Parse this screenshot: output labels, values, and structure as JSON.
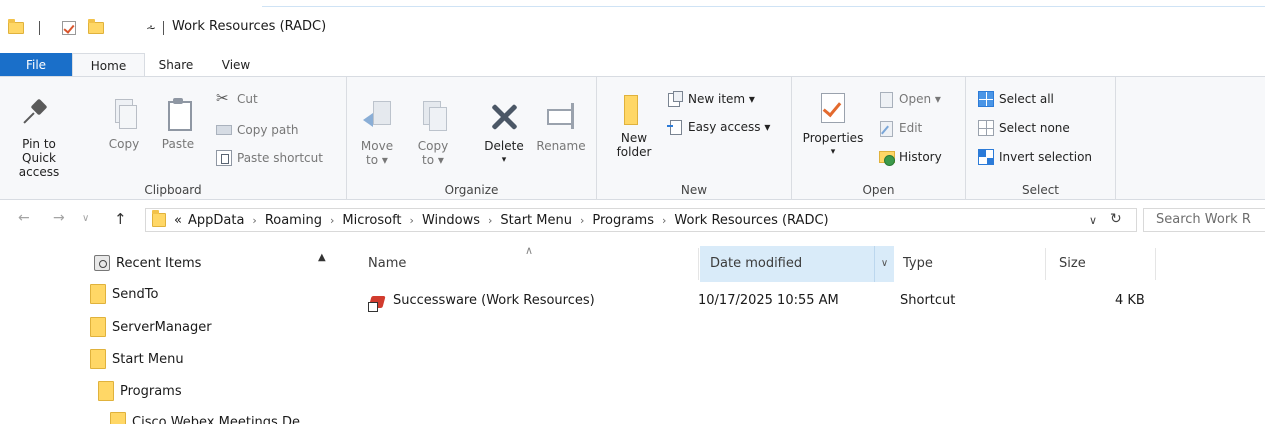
{
  "window": {
    "title": "Work Resources (RADC)"
  },
  "tabs": [
    "File",
    "Home",
    "Share",
    "View"
  ],
  "ribbon": {
    "clipboard": {
      "label": "Clipboard",
      "pin_to_quick_access_line1": "Pin to Quick",
      "pin_to_quick_access_line2": "access",
      "copy": "Copy",
      "paste": "Paste",
      "cut": "Cut",
      "copy_path": "Copy path",
      "paste_shortcut": "Paste shortcut"
    },
    "organize": {
      "label": "Organize",
      "move_to_line1": "Move",
      "move_to_line2": "to ▾",
      "copy_to_line1": "Copy",
      "copy_to_line2": "to ▾",
      "delete": "Delete",
      "delete_arrow": "▾",
      "rename": "Rename"
    },
    "new": {
      "label": "New",
      "new_folder_line1": "New",
      "new_folder_line2": "folder",
      "new_item": "New item ▾",
      "easy_access": "Easy access ▾"
    },
    "open": {
      "label": "Open",
      "properties": "Properties",
      "properties_arrow": "▾",
      "open": "Open ▾",
      "edit": "Edit",
      "history": "History"
    },
    "select": {
      "label": "Select",
      "select_all": "Select all",
      "select_none": "Select none",
      "invert_selection": "Invert selection"
    }
  },
  "address": {
    "overflow": "«",
    "crumbs": [
      "AppData",
      "Roaming",
      "Microsoft",
      "Windows",
      "Start Menu",
      "Programs",
      "Work Resources (RADC)"
    ],
    "search_placeholder": "Search Work R"
  },
  "nav_tree": [
    {
      "label": "Recent Items",
      "icon": "recent-items-icon"
    },
    {
      "label": "SendTo",
      "icon": "folder-icon"
    },
    {
      "label": "ServerManager",
      "icon": "folder-icon"
    },
    {
      "label": "Start Menu",
      "icon": "folder-icon"
    },
    {
      "label": "Programs",
      "icon": "folder-icon"
    },
    {
      "label": "Cisco Webex Meetings De",
      "icon": "folder-icon"
    }
  ],
  "file_list": {
    "columns": [
      "Name",
      "Date modified",
      "Type",
      "Size"
    ],
    "sorted_by": "Date modified",
    "rows": [
      {
        "name": "Successware (Work Resources)",
        "date_modified": "10/17/2025 10:55 AM",
        "type": "Shortcut",
        "size": "4 KB",
        "icon": "shortcut-app-icon"
      }
    ]
  },
  "colors": {
    "file_tab": "#1a6fc9",
    "sorted_header": "#d9ebf9",
    "folder": "#ffd766"
  }
}
